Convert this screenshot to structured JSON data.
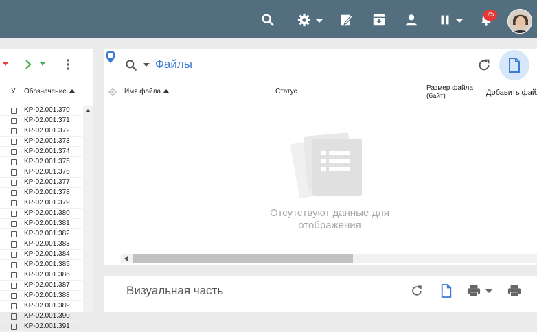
{
  "topbar": {
    "icons": [
      "search-icon",
      "gear-icon",
      "edit-icon",
      "archive-icon",
      "user-icon",
      "pause-icon",
      "bell-icon"
    ],
    "notifications_count": "75",
    "background_color": "#536e7e"
  },
  "left_panel": {
    "columns": {
      "u": "У",
      "code": "Обозначение"
    },
    "rows": [
      "KP-02.001.370",
      "KP-02.001.371",
      "KP-02.001.372",
      "KP-02.001.373",
      "KP-02.001.374",
      "KP-02.001.375",
      "KP-02.001.376",
      "KP-02.001.377",
      "KP-02.001.378",
      "KP-02.001.379",
      "KP-02.001.380",
      "KP-02.001.381",
      "KP-02.001.382",
      "KP-02.001.383",
      "KP-02.001.384",
      "KP-02.001.385",
      "KP-02.001.386",
      "KP-02.001.387",
      "KP-02.001.388",
      "KP-02.001.389",
      "KP-02.001.390",
      "KP-02.001.391"
    ]
  },
  "files_panel": {
    "title": "Файлы",
    "columns": {
      "name": "Имя файла",
      "status": "Статус",
      "size_line1": "Размер файла",
      "size_line2": "(байт)"
    },
    "empty_line1": "Отсутствуют данные для",
    "empty_line2": "отображения",
    "tooltip": "Добавить файл",
    "accent_color": "#3a7bd5"
  },
  "visual_panel": {
    "title": "Визуальная часть"
  }
}
